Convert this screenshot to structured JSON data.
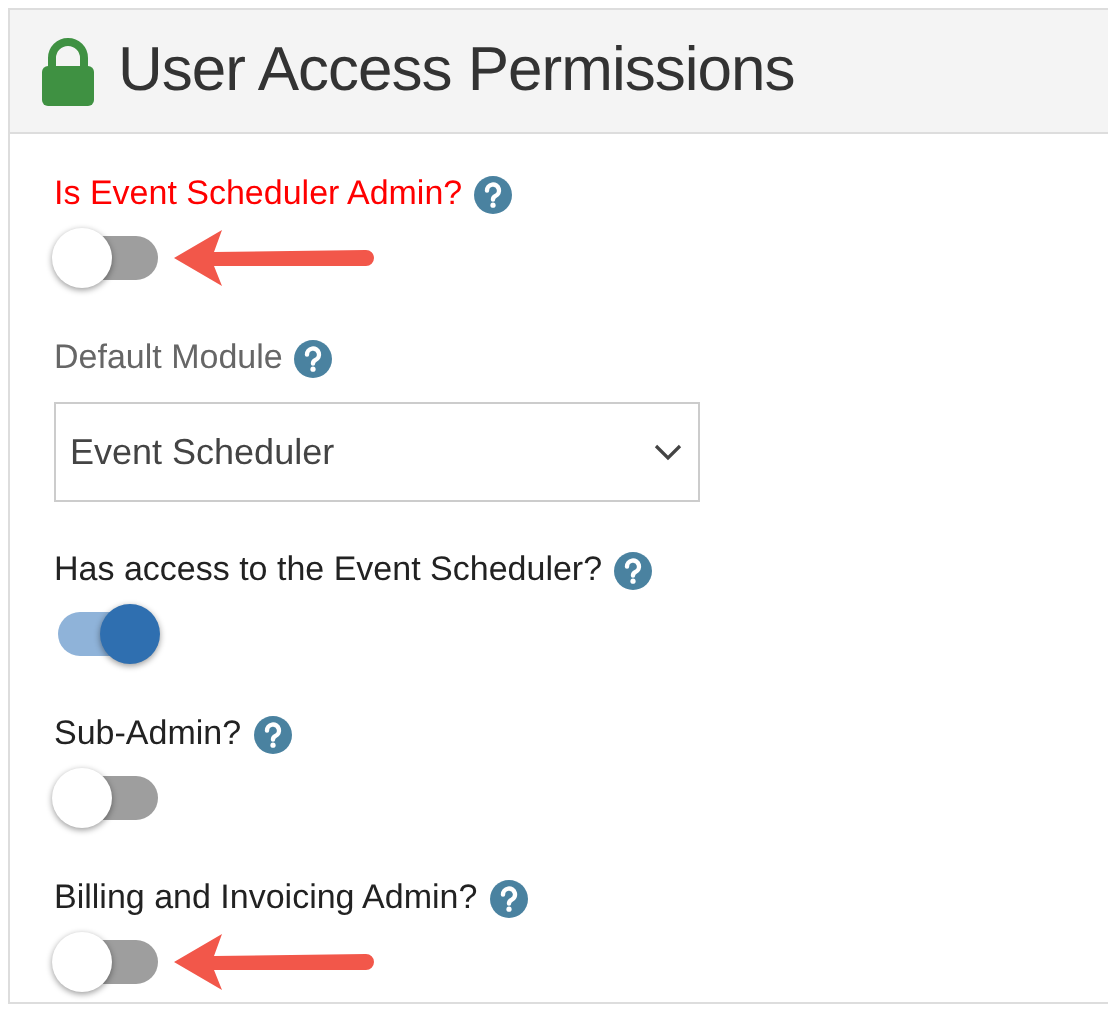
{
  "panel": {
    "title": "User Access Permissions"
  },
  "fields": [
    {
      "kind": "toggle",
      "label": "Is Event Scheduler Admin?",
      "error": true,
      "on": false,
      "annotated": true
    },
    {
      "kind": "select",
      "label": "Default Module",
      "value": "Event Scheduler"
    },
    {
      "kind": "toggle",
      "label": "Has access to the Event Scheduler?",
      "error": false,
      "on": true,
      "annotated": false
    },
    {
      "kind": "toggle",
      "label": "Sub-Admin?",
      "error": false,
      "on": false,
      "annotated": false
    },
    {
      "kind": "toggle",
      "label": "Billing and Invoicing Admin?",
      "error": false,
      "on": false,
      "annotated": true
    }
  ]
}
